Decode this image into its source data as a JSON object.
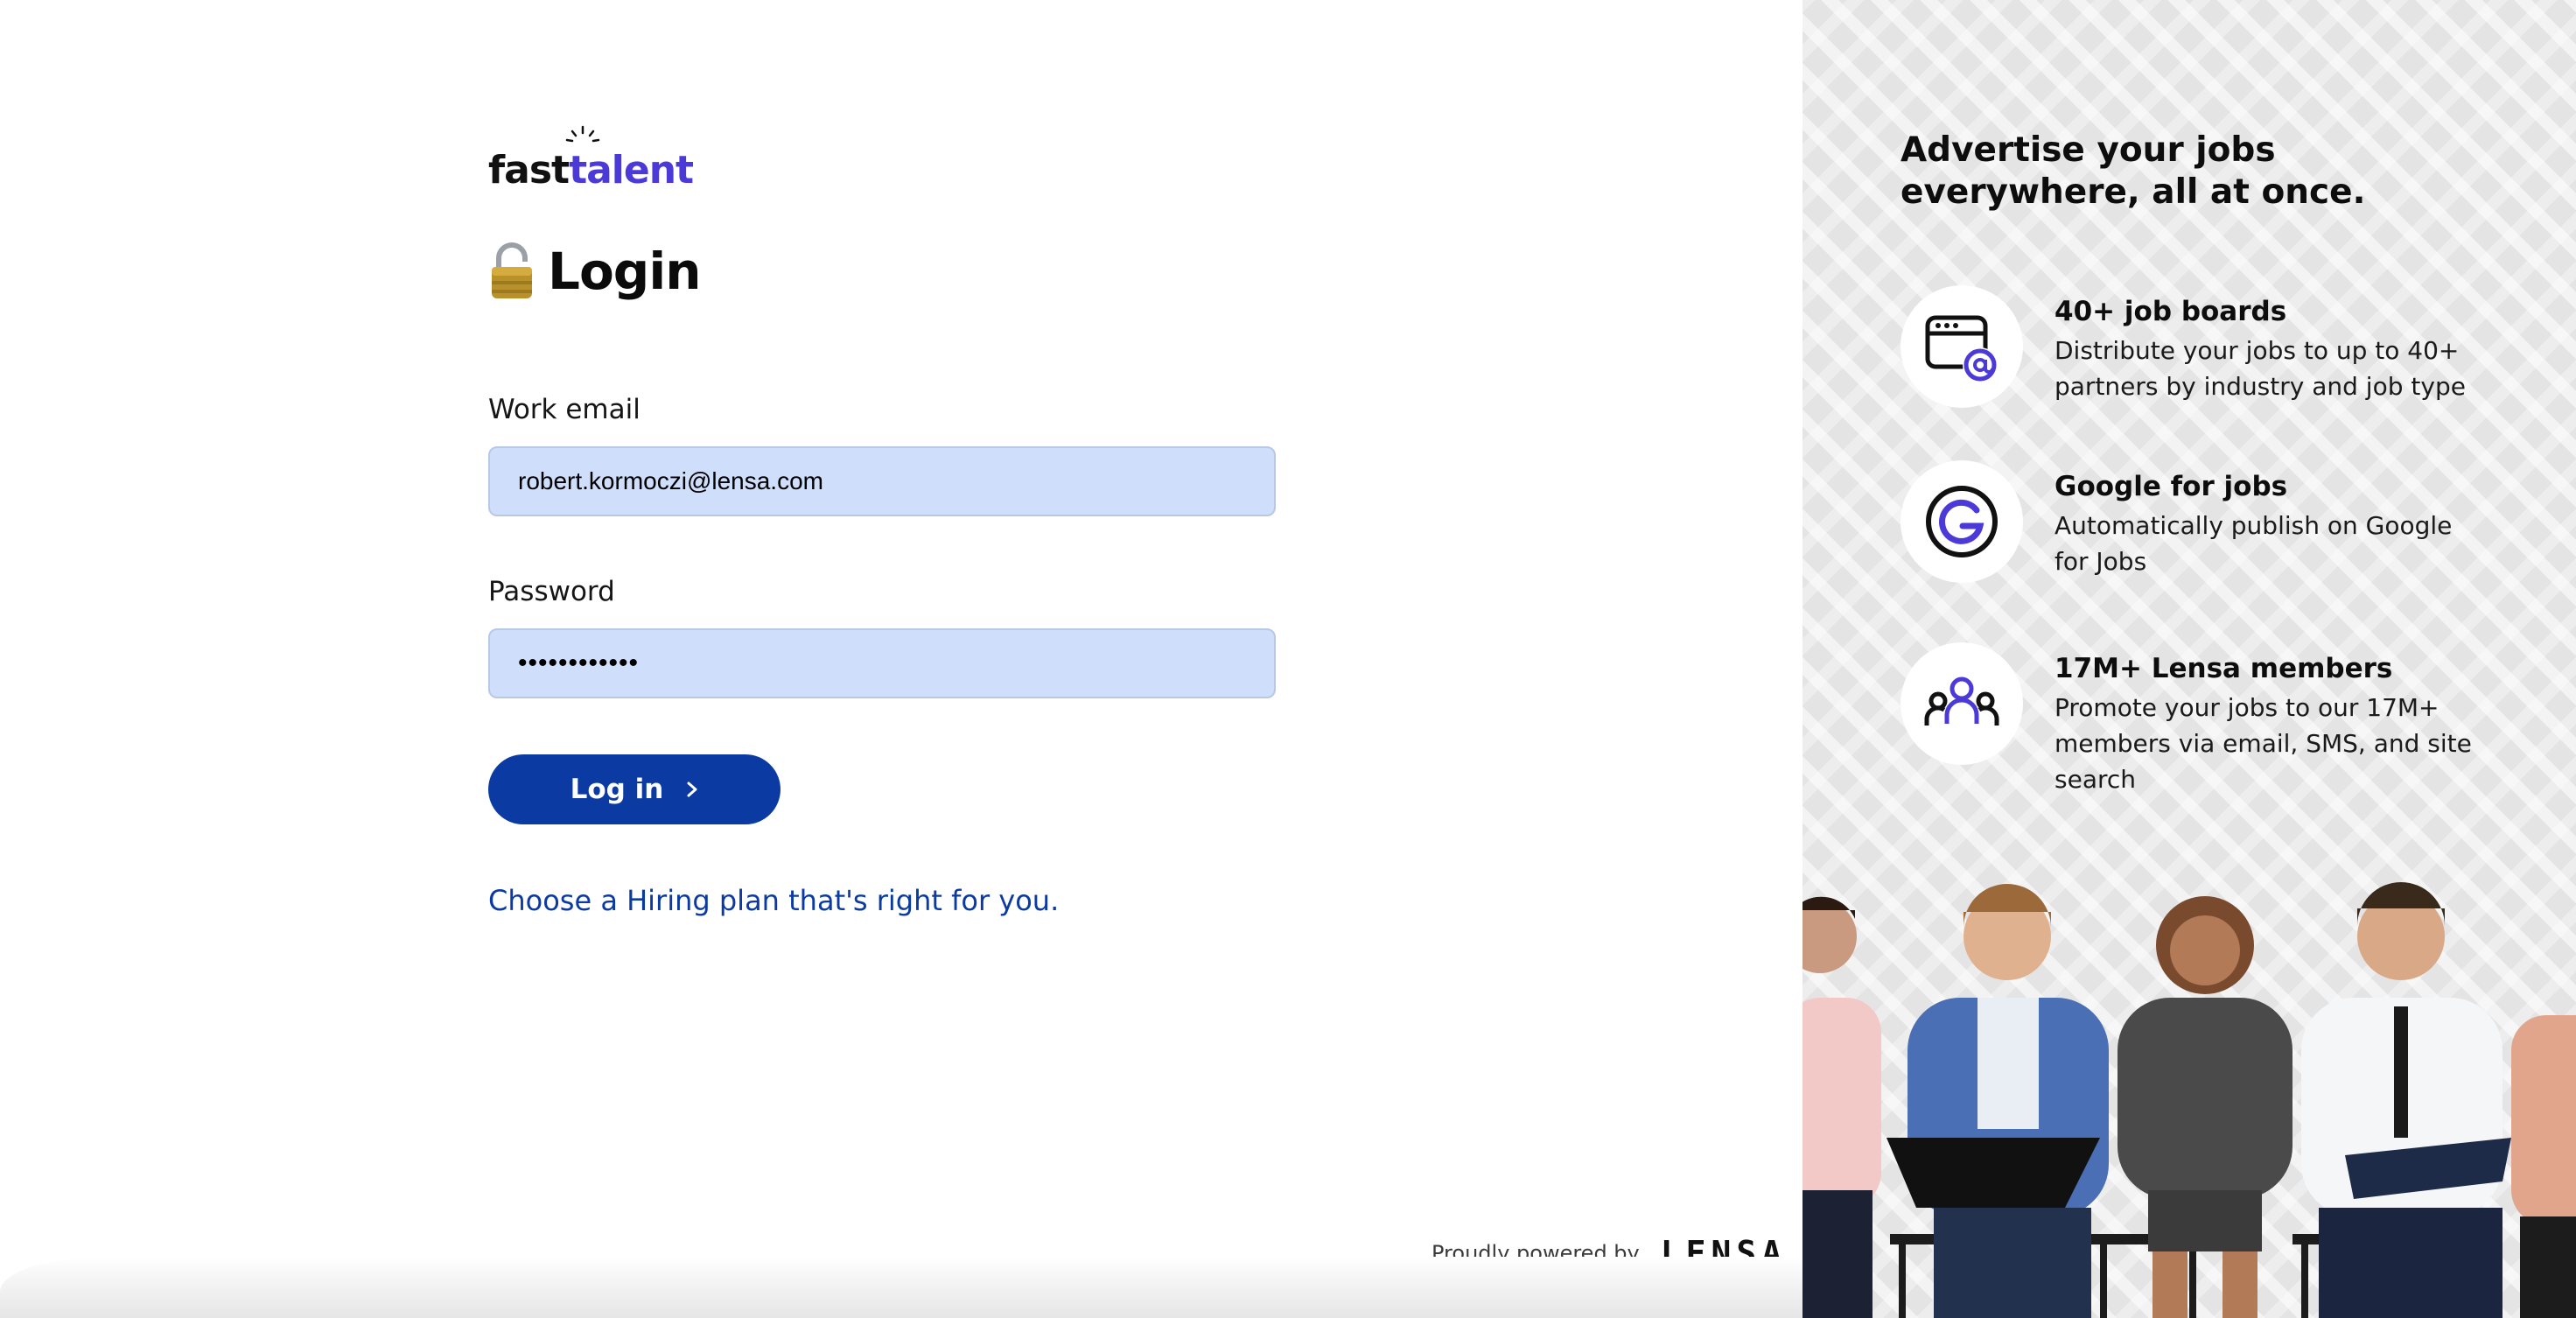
{
  "brand": {
    "logo_part1": "fast",
    "logo_part2": "talent"
  },
  "login": {
    "title": "Login",
    "email_label": "Work email",
    "email_value": "robert.kormoczi@lensa.com",
    "password_label": "Password",
    "password_value": "••••••••••••",
    "submit_label": "Log in",
    "plan_link": "Choose a Hiring plan that's right for you."
  },
  "footer": {
    "powered_text": "Proudly powered by",
    "powered_brand": "LENSA"
  },
  "promo": {
    "headline": "Advertise your jobs everywhere, all at once.",
    "features": [
      {
        "title": "40+ job boards",
        "desc": "Distribute your jobs to up to 40+ partners by industry and job type",
        "icon": "browser-at-icon"
      },
      {
        "title": "Google for jobs",
        "desc": "Automatically publish on Google for Jobs",
        "icon": "google-g-icon"
      },
      {
        "title": "17M+ Lensa members",
        "desc": "Promote your jobs to our 17M+ members via email, SMS, and site search",
        "icon": "members-icon"
      }
    ]
  },
  "colors": {
    "primary": "#0b3aa3",
    "accent": "#4b3ad8",
    "input_bg": "#cfdefb"
  }
}
